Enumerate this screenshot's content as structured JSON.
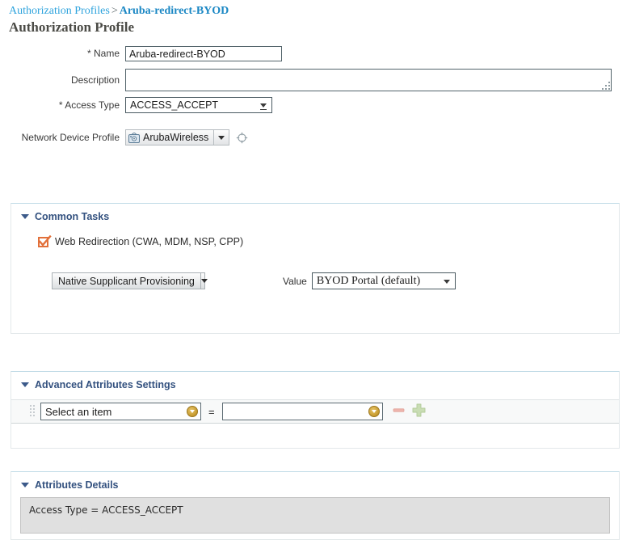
{
  "breadcrumb": {
    "parent": "Authorization Profiles",
    "separator": ">",
    "current": "Aruba-redirect-BYOD"
  },
  "page": {
    "title": "Authorization Profile"
  },
  "form": {
    "name": {
      "label": "Name",
      "required_marker": "*",
      "value": "Aruba-redirect-BYOD"
    },
    "description": {
      "label": "Description",
      "value": "",
      "placeholder": ""
    },
    "access_type": {
      "label": "Access Type",
      "required_marker": "*",
      "value": "ACCESS_ACCEPT"
    },
    "network_device_profile": {
      "label": "Network Device Profile",
      "value": "ArubaWireless",
      "device_icon": "wireless-device-icon",
      "target_icon": "crosshair-target-icon"
    }
  },
  "common_tasks": {
    "title": "Common Tasks",
    "caret_icon": "caret-down-icon",
    "web_redirection": {
      "label": "Web Redirection (CWA, MDM, NSP, CPP)",
      "checked": true
    },
    "redirect_type": {
      "value": "Native Supplicant Provisioning"
    },
    "value_field": {
      "label": "Value",
      "value": "BYOD Portal (default)"
    }
  },
  "advanced_attributes": {
    "title": "Advanced Attributes Settings",
    "caret_icon": "caret-down-icon",
    "rows": [
      {
        "attribute": "Select an item",
        "operator": "=",
        "value": "",
        "grip_icon": "drag-grip-icon",
        "remove_icon": "minus-icon",
        "add_icon": "plus-icon"
      }
    ]
  },
  "attributes_details": {
    "title": "Attributes Details",
    "caret_icon": "caret-down-icon",
    "content": "Access Type = ACCESS_ACCEPT"
  },
  "colors": {
    "breadcrumb_link": "#2da3dd",
    "panel_title": "#33517f",
    "checkbox_accent": "#e2703a",
    "gold_button": "#c69a2e",
    "minus": "#e8a9a2",
    "plus": "#bcd6a4",
    "detail_bg": "#e0e0e0"
  }
}
